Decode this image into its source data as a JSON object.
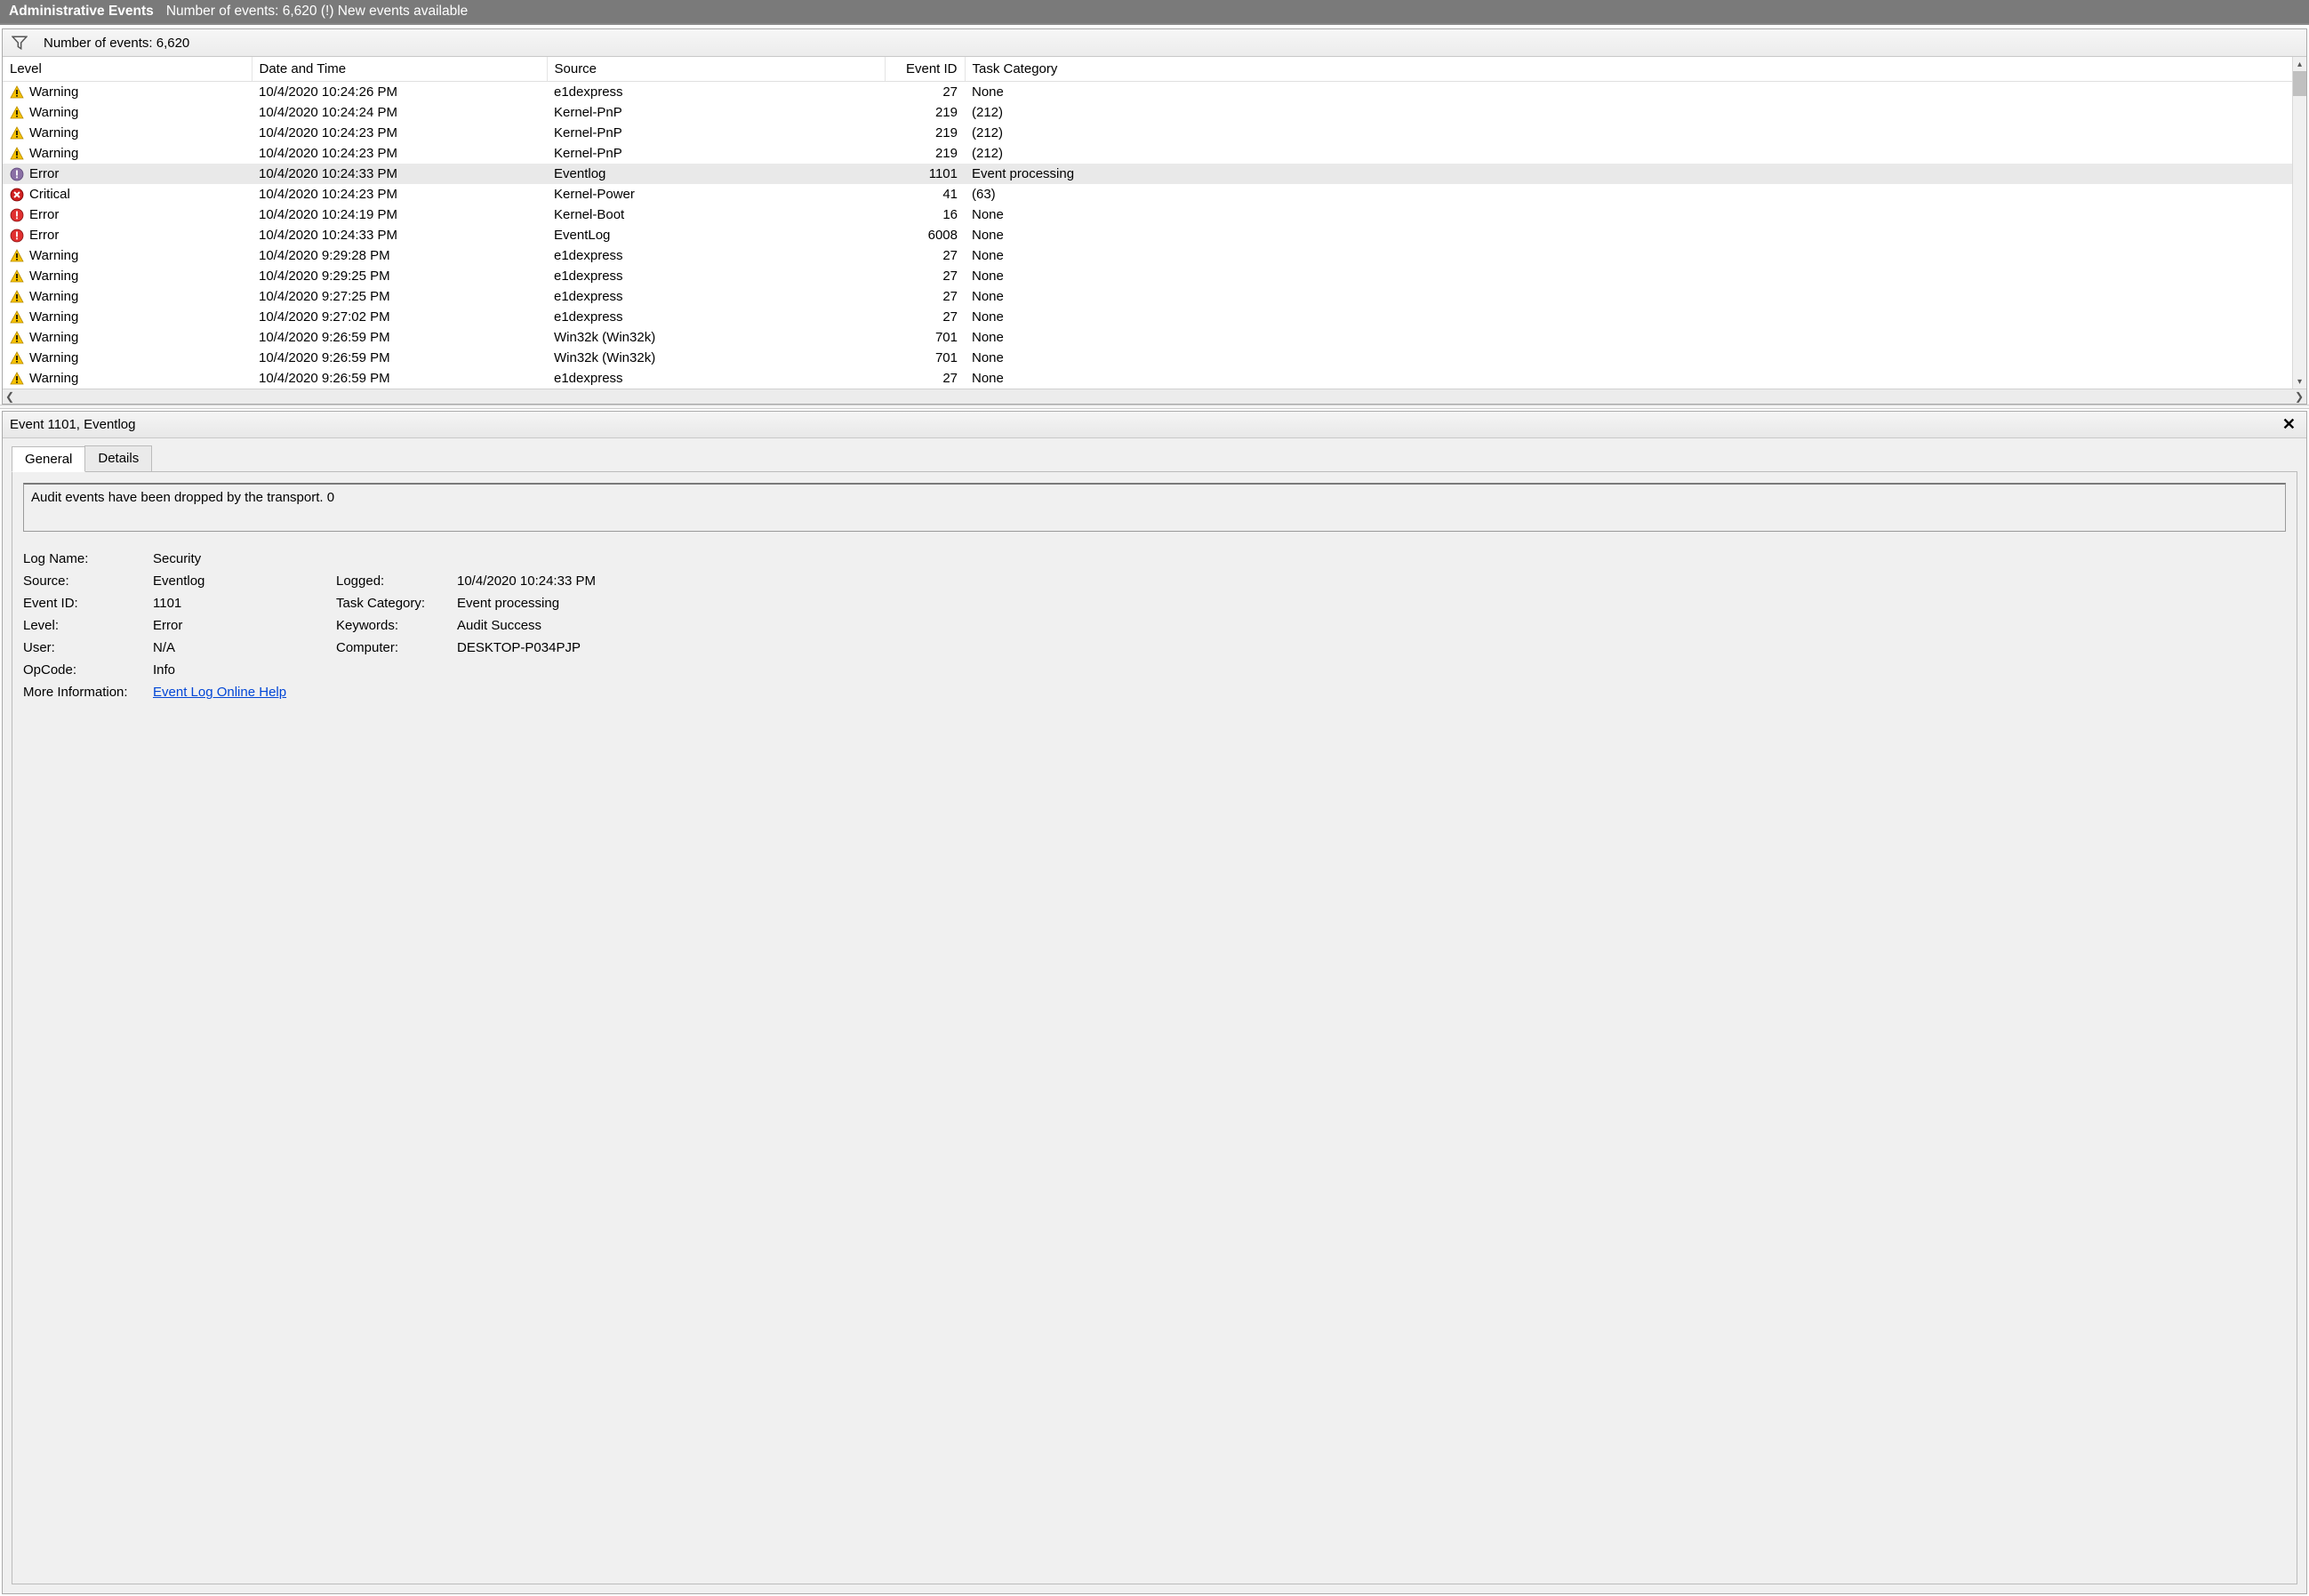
{
  "titlebar": {
    "title": "Administrative Events",
    "subtitle": "Number of events: 6,620 (!) New events available"
  },
  "filterbar": {
    "count_text": "Number of events: 6,620"
  },
  "columns": {
    "level": "Level",
    "date": "Date and Time",
    "source": "Source",
    "id": "Event ID",
    "task": "Task Category"
  },
  "rows": [
    {
      "level": "Warning",
      "icon": "warning",
      "date": "10/4/2020 10:24:26 PM",
      "source": "e1dexpress",
      "id": "27",
      "task": "None",
      "selected": false
    },
    {
      "level": "Warning",
      "icon": "warning",
      "date": "10/4/2020 10:24:24 PM",
      "source": "Kernel-PnP",
      "id": "219",
      "task": "(212)",
      "selected": false
    },
    {
      "level": "Warning",
      "icon": "warning",
      "date": "10/4/2020 10:24:23 PM",
      "source": "Kernel-PnP",
      "id": "219",
      "task": "(212)",
      "selected": false
    },
    {
      "level": "Warning",
      "icon": "warning",
      "date": "10/4/2020 10:24:23 PM",
      "source": "Kernel-PnP",
      "id": "219",
      "task": "(212)",
      "selected": false
    },
    {
      "level": "Error",
      "icon": "error-gray",
      "date": "10/4/2020 10:24:33 PM",
      "source": "Eventlog",
      "id": "1101",
      "task": "Event processing",
      "selected": true
    },
    {
      "level": "Critical",
      "icon": "critical",
      "date": "10/4/2020 10:24:23 PM",
      "source": "Kernel-Power",
      "id": "41",
      "task": "(63)",
      "selected": false
    },
    {
      "level": "Error",
      "icon": "error",
      "date": "10/4/2020 10:24:19 PM",
      "source": "Kernel-Boot",
      "id": "16",
      "task": "None",
      "selected": false
    },
    {
      "level": "Error",
      "icon": "error",
      "date": "10/4/2020 10:24:33 PM",
      "source": "EventLog",
      "id": "6008",
      "task": "None",
      "selected": false
    },
    {
      "level": "Warning",
      "icon": "warning",
      "date": "10/4/2020 9:29:28 PM",
      "source": "e1dexpress",
      "id": "27",
      "task": "None",
      "selected": false
    },
    {
      "level": "Warning",
      "icon": "warning",
      "date": "10/4/2020 9:29:25 PM",
      "source": "e1dexpress",
      "id": "27",
      "task": "None",
      "selected": false
    },
    {
      "level": "Warning",
      "icon": "warning",
      "date": "10/4/2020 9:27:25 PM",
      "source": "e1dexpress",
      "id": "27",
      "task": "None",
      "selected": false
    },
    {
      "level": "Warning",
      "icon": "warning",
      "date": "10/4/2020 9:27:02 PM",
      "source": "e1dexpress",
      "id": "27",
      "task": "None",
      "selected": false
    },
    {
      "level": "Warning",
      "icon": "warning",
      "date": "10/4/2020 9:26:59 PM",
      "source": "Win32k (Win32k)",
      "id": "701",
      "task": "None",
      "selected": false
    },
    {
      "level": "Warning",
      "icon": "warning",
      "date": "10/4/2020 9:26:59 PM",
      "source": "Win32k (Win32k)",
      "id": "701",
      "task": "None",
      "selected": false
    },
    {
      "level": "Warning",
      "icon": "warning",
      "date": "10/4/2020 9:26:59 PM",
      "source": "e1dexpress",
      "id": "27",
      "task": "None",
      "selected": false
    }
  ],
  "detail": {
    "header": "Event 1101, Eventlog",
    "tabs": {
      "general": "General",
      "details": "Details"
    },
    "message": "Audit events have been dropped by the transport.  0",
    "labels": {
      "log_name": "Log Name:",
      "source": "Source:",
      "event_id": "Event ID:",
      "level": "Level:",
      "user": "User:",
      "opcode": "OpCode:",
      "more_info": "More Information:",
      "logged": "Logged:",
      "task_category": "Task Category:",
      "keywords": "Keywords:",
      "computer": "Computer:"
    },
    "values": {
      "log_name": "Security",
      "source": "Eventlog",
      "event_id": "1101",
      "level": "Error",
      "user": "N/A",
      "opcode": "Info",
      "more_info": "Event Log Online Help",
      "logged": "10/4/2020 10:24:33 PM",
      "task_category": "Event processing",
      "keywords": "Audit Success",
      "computer": "DESKTOP-P034PJP"
    }
  }
}
